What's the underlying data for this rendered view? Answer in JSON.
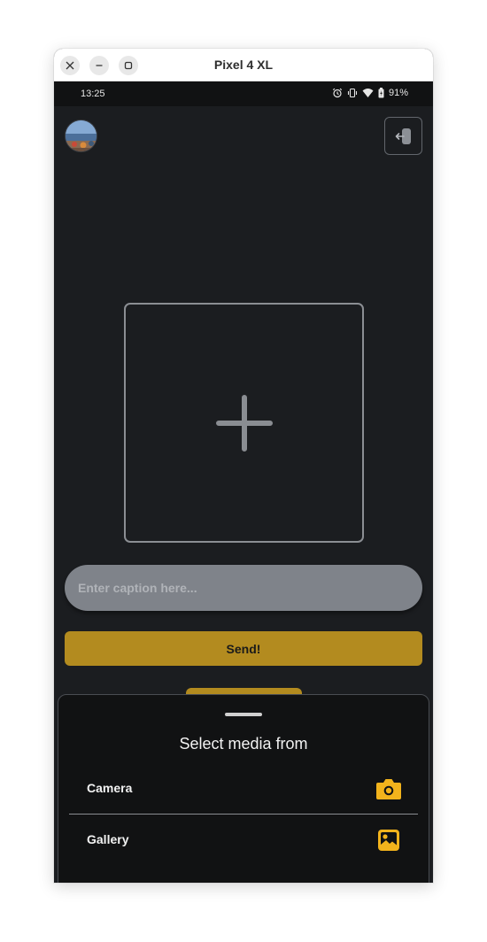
{
  "window": {
    "title": "Pixel 4 XL"
  },
  "status_bar": {
    "time": "13:25",
    "battery": "91%"
  },
  "caption": {
    "placeholder": "Enter caption here..."
  },
  "send_button": {
    "label": "Send!"
  },
  "media_sheet": {
    "title": "Select media from",
    "items": [
      {
        "label": "Camera",
        "icon": "camera-icon"
      },
      {
        "label": "Gallery",
        "icon": "image-icon"
      }
    ]
  },
  "colors": {
    "accent": "#b38b1f",
    "icon_accent": "#f2b31c",
    "background": "#1b1d20",
    "sheet_background": "#111213",
    "input_background": "#7f838a"
  }
}
